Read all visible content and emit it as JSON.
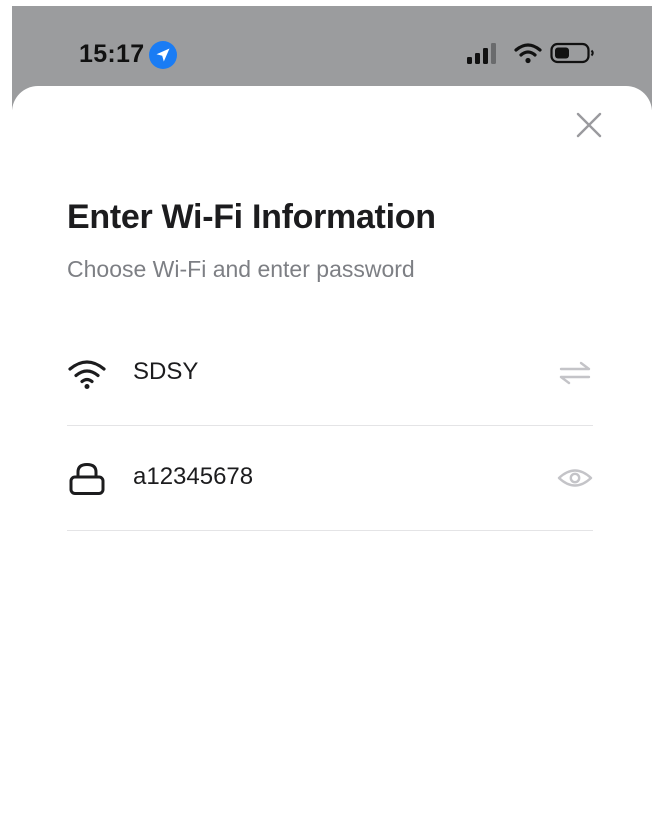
{
  "status_bar": {
    "time": "15:17",
    "icons": [
      "location-arrow-icon",
      "cellular-signal-icon",
      "wifi-icon",
      "battery-icon"
    ]
  },
  "sheet": {
    "title": "Enter Wi-Fi Information",
    "subtitle": "Choose Wi-Fi and enter password",
    "close_icon": "close-icon"
  },
  "fields": {
    "wifi": {
      "icon": "wifi-icon",
      "value": "SDSY",
      "action_icon": "switch-network-icon"
    },
    "password": {
      "icon": "lock-icon",
      "value": "a12345678",
      "action_icon": "eye-icon"
    }
  },
  "colors": {
    "dim_overlay": "#9b9c9e",
    "title": "#1c1c1e",
    "subtitle": "#7d7f84",
    "divider": "#e4e4e6",
    "location_accent": "#1a7cf4",
    "muted_icon": "#c4c4c8"
  }
}
